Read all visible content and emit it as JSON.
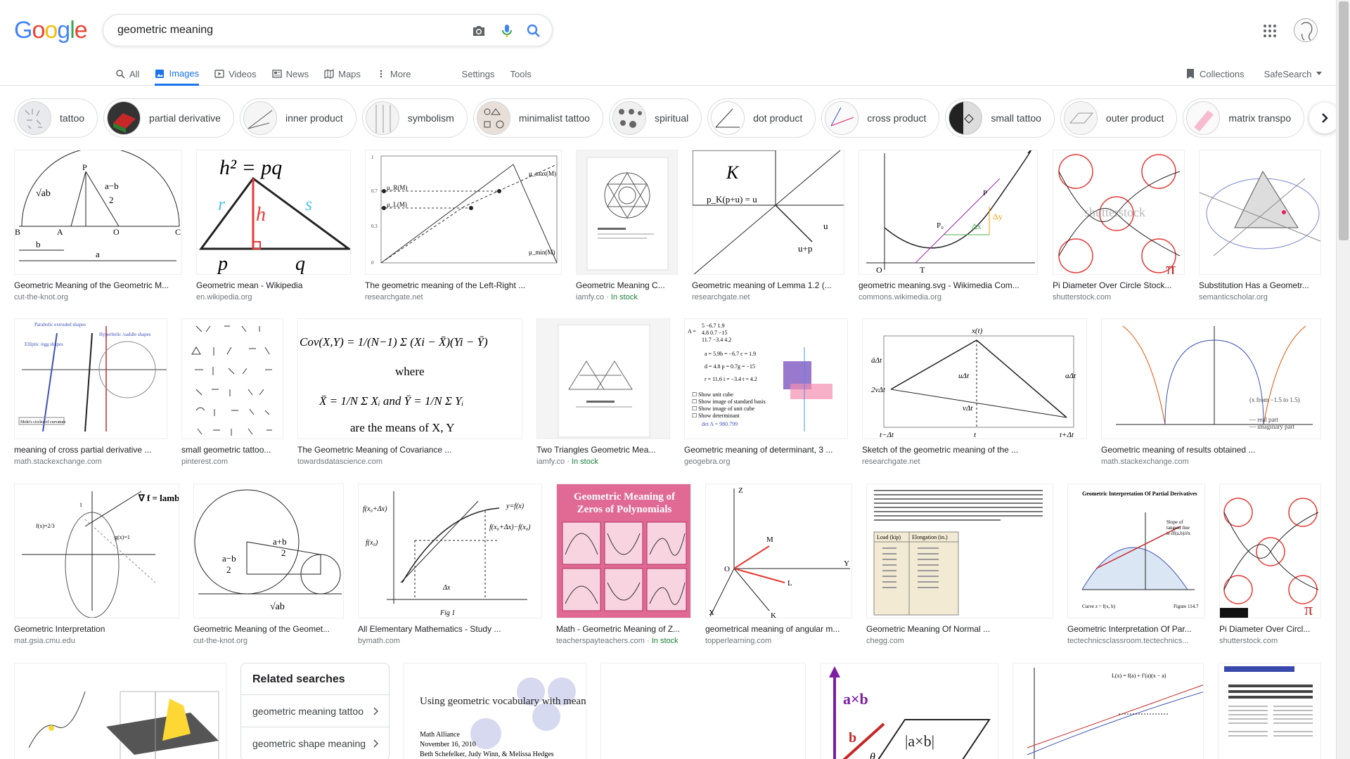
{
  "logo": "Google",
  "search": {
    "query": "geometric meaning"
  },
  "tabs": [
    "All",
    "Images",
    "Videos",
    "News",
    "Maps",
    "More"
  ],
  "tools": [
    "Settings",
    "Tools"
  ],
  "right": {
    "collections": "Collections",
    "safesearch": "SafeSearch"
  },
  "chips": [
    "tattoo",
    "partial derivative",
    "inner product",
    "symbolism",
    "minimalist tattoo",
    "spiritual",
    "dot product",
    "cross product",
    "small tattoo",
    "outer product",
    "matrix transpo"
  ],
  "results": [
    {
      "caption": "Geometric Meaning of the Geometric M...",
      "source": "cut-the-knot.org",
      "stock": ""
    },
    {
      "caption": "Geometric mean - Wikipedia",
      "source": "en.wikipedia.org",
      "stock": ""
    },
    {
      "caption": "The geometric meaning of the Left-Right ...",
      "source": "researchgate.net",
      "stock": ""
    },
    {
      "caption": "Geometric Meaning C...",
      "source": "iamfy.co",
      "stock": "In stock"
    },
    {
      "caption": "Geometric meaning of Lemma 1.2 (...",
      "source": "researchgate.net",
      "stock": ""
    },
    {
      "caption": "geometric meaning.svg - Wikimedia Com...",
      "source": "commons.wikimedia.org",
      "stock": ""
    },
    {
      "caption": "Pi Diameter Over Circle Stock...",
      "source": "shutterstock.com",
      "stock": ""
    },
    {
      "caption": "Substitution Has a Geometr...",
      "source": "semanticscholar.org",
      "stock": ""
    },
    {
      "caption": "meaning of cross partial derivative ...",
      "source": "math.stackexchange.com",
      "stock": ""
    },
    {
      "caption": "small geometric tattoo...",
      "source": "pinterest.com",
      "stock": ""
    },
    {
      "caption": "The Geometric Meaning of Covariance ...",
      "source": "towardsdatascience.com",
      "stock": ""
    },
    {
      "caption": "Two Triangles Geometric Mea...",
      "source": "iamfy.co",
      "stock": "In stock"
    },
    {
      "caption": "Geometric meaning of determinant, 3 ...",
      "source": "geogebra.org",
      "stock": ""
    },
    {
      "caption": "Sketch of the geometric meaning of the ...",
      "source": "researchgate.net",
      "stock": ""
    },
    {
      "caption": "Geometric meaning of results obtained ...",
      "source": "math.stackexchange.com",
      "stock": ""
    },
    {
      "caption": "Geometric Interpretation",
      "source": "mat.gsia.cmu.edu",
      "stock": ""
    },
    {
      "caption": "Geometric Meaning of the Geomet...",
      "source": "cut-the-knot.org",
      "stock": ""
    },
    {
      "caption": "All Elementary Mathematics - Study ...",
      "source": "bymath.com",
      "stock": ""
    },
    {
      "caption": "Math - Geometric Meaning of Z...",
      "source": "teacherspayteachers.com",
      "stock": "In stock"
    },
    {
      "caption": "geometrical meaning of angular m...",
      "source": "topperlearning.com",
      "stock": ""
    },
    {
      "caption": "Geometric Meaning Of Normal ...",
      "source": "chegg.com",
      "stock": ""
    },
    {
      "caption": "Geometric Interpretation Of Par...",
      "source": "tectechnicsclassroom.tectechnics...",
      "stock": ""
    },
    {
      "caption": "Pi Diameter Over Circl...",
      "source": "shutterstock.com",
      "stock": ""
    }
  ],
  "related": {
    "title": "Related searches",
    "items": [
      "geometric meaning tattoo",
      "geometric shape meaning"
    ]
  },
  "image_text": {
    "wiki_formula": "h² = pq",
    "cov_formula": "Cov(X,Y) = 1/(N−1) Σ (Xi − X̄)(Yi − Ȳ)",
    "cov_where": "where",
    "cov_means": "are the means of X, Y",
    "tpt_title": "Geometric Meaning of Zeros of Polynomials",
    "vocab_title": "Using geometric vocabulary with meaning",
    "vocab_org": "Math Alliance",
    "vocab_date": "November 16, 2010",
    "vocab_authors": "Beth Schefelker, Judy Winn, & Melissa Hedges",
    "cross_label": "a×b"
  }
}
